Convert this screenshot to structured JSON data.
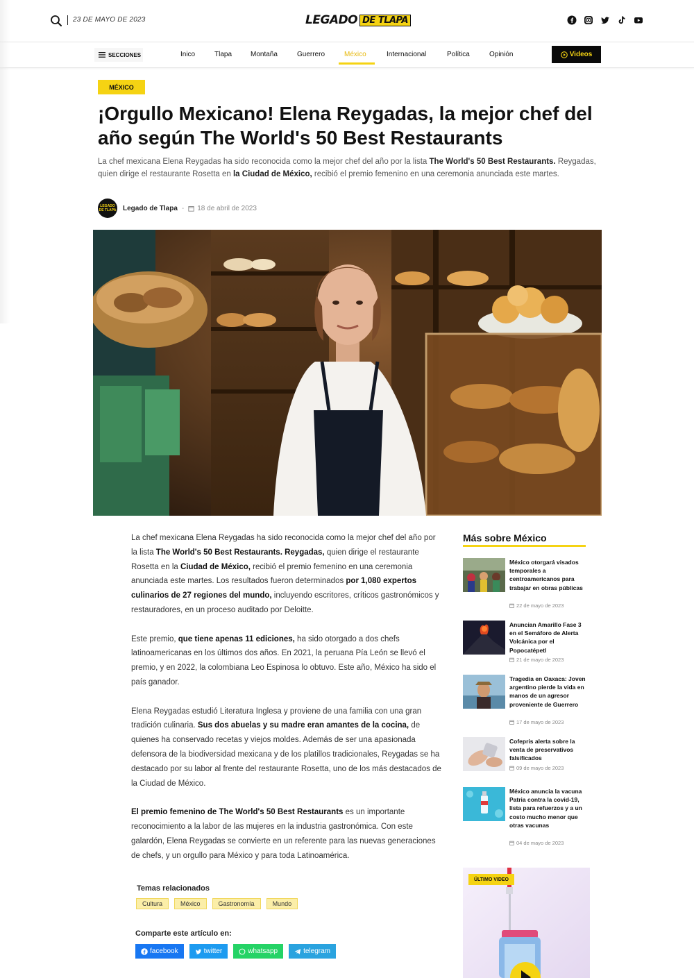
{
  "header": {
    "date": "23 DE MAYO DE 2023",
    "logo_part1": "LEGADO",
    "logo_part2": "DE TLAPA",
    "socials": [
      "facebook-icon",
      "instagram-icon",
      "twitter-icon",
      "tiktok-icon",
      "youtube-icon"
    ]
  },
  "nav": {
    "secciones": "SECCIONES",
    "items": [
      "Inico",
      "Tlapa",
      "Montaña",
      "Guerrero",
      "México",
      "Internacional",
      "Política",
      "Opinión"
    ],
    "active": "México",
    "videos": "Videos"
  },
  "article": {
    "category": "MÉXICO",
    "title": "¡Orgullo Mexicano! Elena Reygadas, la mejor chef del año según The World's 50 Best Restaurants",
    "lede": {
      "t1": "La chef mexicana Elena Reygadas ha sido reconocida como la mejor chef del año por la lista ",
      "b1": "The World's 50 Best Restaurants.",
      "t2": " Reygadas, quien dirige el restaurante Rosetta en ",
      "b2": "la Ciudad de México,",
      "t3": " recibió el premio femenino en una ceremonia anunciada este martes."
    },
    "author_avatar": "LEGADO DE TLAPA",
    "author": "Legado de Tlapa",
    "date": "18 de abril de 2023",
    "p1": {
      "t1": "La chef mexicana Elena Reygadas ha sido reconocida como la mejor chef del año por la lista ",
      "b1": "The World's 50 Best Restaurants. Reygadas,",
      "t2": " quien dirige el restaurante Rosetta en la ",
      "b2": "Ciudad de México,",
      "t3": " recibió el premio femenino en una ceremonia anunciada este martes. Los resultados fueron determinados ",
      "b3": "por 1,080 expertos culinarios de 27 regiones del mundo,",
      "t4": " incluyendo escritores, críticos gastronómicos y restauradores, en un proceso auditado por Deloitte."
    },
    "p2": {
      "t1": "Este premio, ",
      "b1": "que tiene apenas 11 ediciones,",
      "t2": " ha sido otorgado a dos chefs latinoamericanas en los últimos dos años. En 2021, la peruana Pía León se llevó el premio, y en 2022, la colombiana Leo Espinosa lo obtuvo. Este año, México ha sido el país ganador."
    },
    "p3": {
      "t1": "Elena Reygadas estudió Literatura Inglesa y proviene de una familia con una gran tradición culinaria. ",
      "b1": "Sus dos abuelas y su madre eran amantes de la cocina,",
      "t2": " de quienes ha conservado recetas y viejos moldes. Además de ser una apasionada defensora de la biodiversidad mexicana y de los platillos tradicionales, Reygadas se ha destacado por su labor al frente del restaurante Rosetta, uno de los más destacados de la Ciudad de México."
    },
    "p4": {
      "b1": "El premio femenino de The World's 50 Best Restaurants",
      "t1": " es un importante reconocimiento a la labor de las mujeres en la industria gastronómica. Con este galardón, Elena Reygadas se convierte en un referente para las nuevas generaciones de chefs, y un orgullo para México y para toda Latinoamérica."
    },
    "tags_title": "Temas relacionados",
    "tags": [
      "Cultura",
      "México",
      "Gastronomía",
      "Mundo"
    ],
    "share_title": "Comparte este artículo en:",
    "shares": [
      {
        "label": "facebook",
        "color": "#1877f2"
      },
      {
        "label": "twitter",
        "color": "#1d9bf0"
      },
      {
        "label": "whatsapp",
        "color": "#25d366"
      },
      {
        "label": "telegram",
        "color": "#2aa3df"
      }
    ]
  },
  "sidebar": {
    "title": "Más sobre México",
    "items": [
      {
        "title": "México otorgará visados temporales a centroamericanos para trabajar en obras públicas",
        "date": "22 de mayo de 2023"
      },
      {
        "title": "Anuncian Amarillo Fase 3 en el Semáforo de Alerta Volcánica por el Popocatépetl",
        "date": "21 de mayo de 2023"
      },
      {
        "title": "Tragedia en Oaxaca: Joven argentino pierde la vida en manos de un agresor proveniente de Guerrero",
        "date": "17 de mayo de 2023"
      },
      {
        "title": "Cofepris alerta sobre la venta de preservativos falsificados",
        "date": "09 de mayo de 2023"
      },
      {
        "title": "México anuncia la vacuna Patria contra la covid-19, lista para refuerzos y a un costo mucho menor que otras vacunas",
        "date": "04 de mayo de 2023"
      }
    ],
    "video_badge": "ÚLTIMO VIDEO"
  },
  "colors": {
    "accent": "#f5d313",
    "dark": "#0a0a0a",
    "tag_bg": "#fbeea8"
  }
}
